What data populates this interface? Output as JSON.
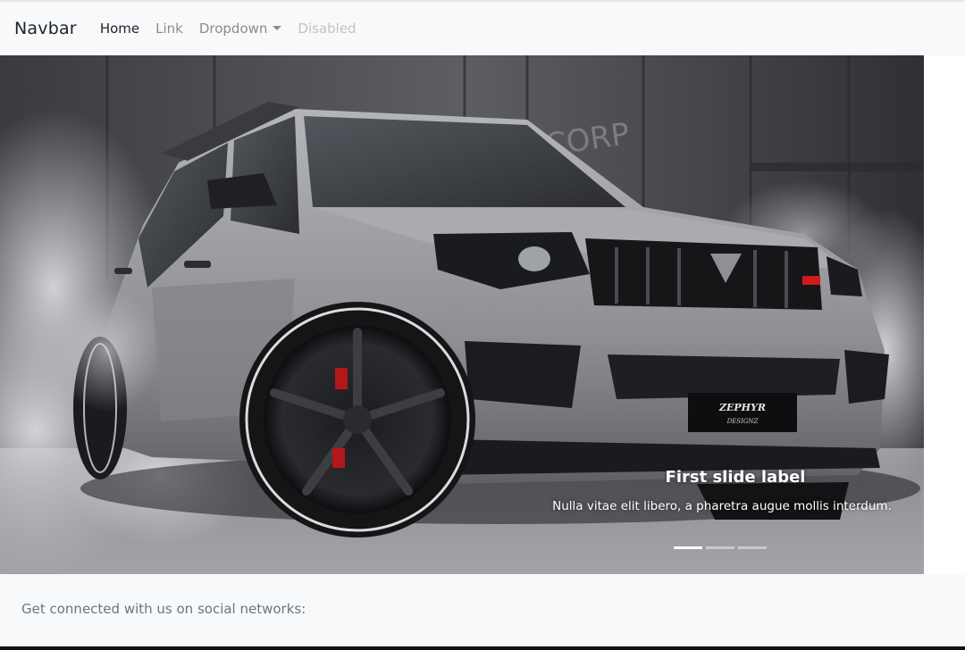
{
  "navbar": {
    "brand": "Navbar",
    "links": [
      {
        "label": "Home",
        "state": "active"
      },
      {
        "label": "Link",
        "state": "normal"
      },
      {
        "label": "Dropdown",
        "state": "dropdown"
      },
      {
        "label": "Disabled",
        "state": "disabled"
      }
    ]
  },
  "carousel": {
    "image": {
      "subject": "grey SUV drifting with tire smoke in front of shipping containers",
      "plate_text": "ZEPHYR DESIGNZ",
      "wall_text": "CORP"
    },
    "caption_title": "First slide label",
    "caption_text": "Nulla vitae elit libero, a pharetra augue mollis interdum.",
    "indicators": {
      "count": 3,
      "active_index": 0
    }
  },
  "footer": {
    "text": "Get connected with us on social networks:"
  },
  "colors": {
    "navbar_bg": "#f8f9fa",
    "active_link": "#212529",
    "muted_link": "#8c8c8c",
    "disabled_link": "#c2c2c2",
    "footer_text": "#6c757d"
  }
}
